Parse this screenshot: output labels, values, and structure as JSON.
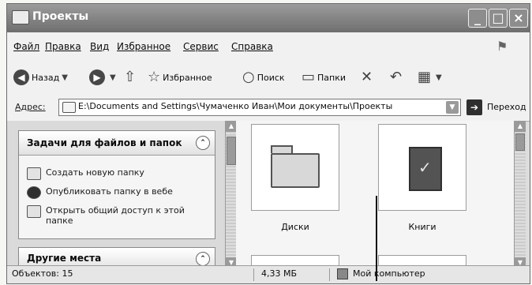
{
  "window": {
    "title": "Проекты"
  },
  "menu": [
    "Файл",
    "Правка",
    "Вид",
    "Избранное",
    "Сервис",
    "Справка"
  ],
  "toolbar": {
    "back_label": "Назад",
    "favorites_label": "Избранное",
    "search_label": "Поиск",
    "folders_label": "Папки"
  },
  "address": {
    "label": "Адрес:",
    "path": "E:\\Documents and Settings\\Чумаченко Иван\\Мои документы\\Проекты",
    "go_label": "Переход"
  },
  "tasks": {
    "header": "Задачи для файлов и папок",
    "items": [
      "Создать новую папку",
      "Опубликовать папку в вебе",
      "Открыть общий доступ к этой папке"
    ]
  },
  "other": {
    "header": "Другие места"
  },
  "files": [
    {
      "name": "Диски",
      "icon": "folder-icon"
    },
    {
      "name": "Книги",
      "icon": "book-icon"
    }
  ],
  "status": {
    "objects": "Объектов: 15",
    "size": "4,33 МБ",
    "location": "Мой компьютер"
  }
}
